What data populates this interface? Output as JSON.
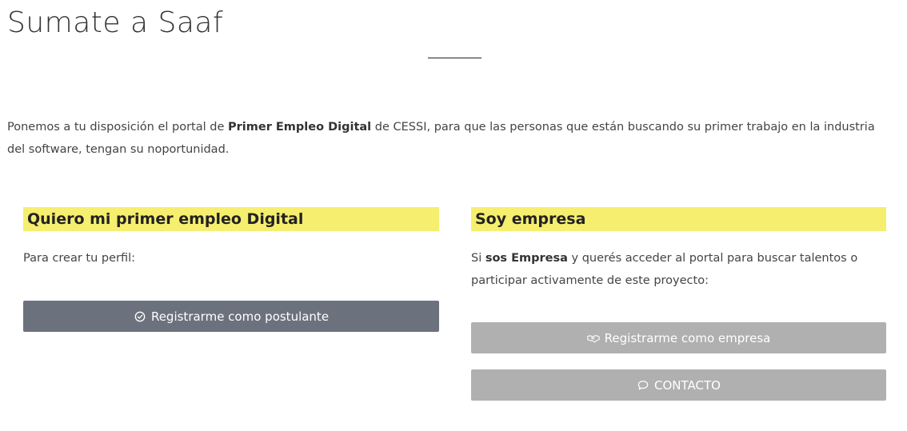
{
  "page": {
    "title": "Sumate a Saaf",
    "intro": {
      "before": "Ponemos a tu disposición el portal de ",
      "bold": "Primer Empleo Digital",
      "after": " de CESSI, para que las personas que están buscando su primer trabajo en la industria del software, tengan su noportunidad."
    }
  },
  "candidate": {
    "heading": "Quiero mi primer empleo Digital",
    "text": "Para crear tu perfil:",
    "button_label": "Registrarme como postulante",
    "button_icon": "check-circle-icon"
  },
  "company": {
    "heading": "Soy empresa",
    "text_before": "Si ",
    "text_bold": "sos Empresa",
    "text_after": " y querés acceder al portal para buscar talentos o participar activamente de este proyecto:",
    "register_label": "Registrarme como empresa",
    "register_icon": "handshake-icon",
    "contact_label": "CONTACTO",
    "contact_icon": "chat-bubble-icon"
  },
  "colors": {
    "highlight": "#f6ee6e",
    "primary_button": "#6c727d",
    "secondary_button": "#b0b0b0"
  }
}
